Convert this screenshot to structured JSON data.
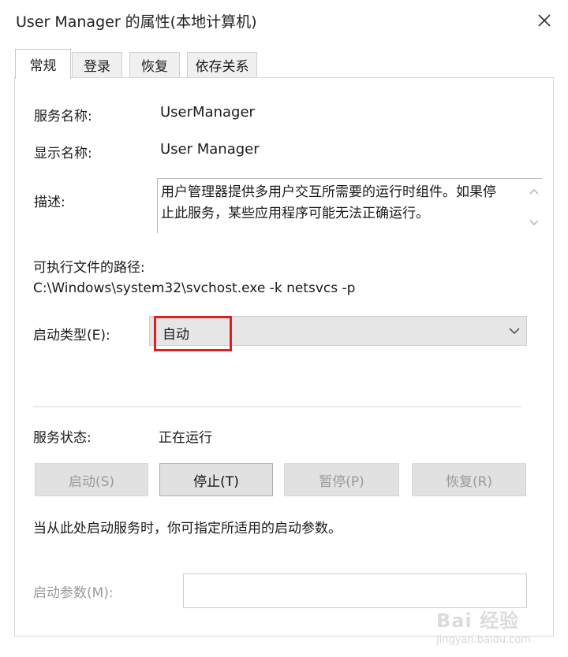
{
  "window": {
    "title": "User Manager 的属性(本地计算机)"
  },
  "tabs": [
    {
      "label": "常规",
      "active": true
    },
    {
      "label": "登录",
      "active": false
    },
    {
      "label": "恢复",
      "active": false
    },
    {
      "label": "依存关系",
      "active": false
    }
  ],
  "general": {
    "service_name_label": "服务名称:",
    "service_name_value": "UserManager",
    "display_name_label": "显示名称:",
    "display_name_value": "User Manager",
    "description_label": "描述:",
    "description_value": "用户管理器提供多用户交互所需要的运行时组件。如果停止此服务，某些应用程序可能无法正确运行。",
    "exe_path_label": "可执行文件的路径:",
    "exe_path_value": "C:\\Windows\\system32\\svchost.exe -k netsvcs -p",
    "startup_type_label": "启动类型(E):",
    "startup_type_value": "自动",
    "service_status_label": "服务状态:",
    "service_status_value": "正在运行",
    "buttons": {
      "start": "启动(S)",
      "stop": "停止(T)",
      "pause": "暂停(P)",
      "resume": "恢复(R)"
    },
    "hint": "当从此处启动服务时，你可指定所适用的启动参数。",
    "start_params_label": "启动参数(M):",
    "start_params_value": ""
  },
  "watermark": {
    "main": "Bai 经验",
    "sub": "jingyan.baidu.com"
  },
  "colors": {
    "highlight_box": "#e02020",
    "disabled_text": "#9a9a9a",
    "button_face": "#e1e1e1"
  },
  "icons": {
    "close": "close-icon",
    "scroll_up": "chevron-up-icon",
    "scroll_down": "chevron-down-icon",
    "dropdown": "chevron-down-icon"
  }
}
